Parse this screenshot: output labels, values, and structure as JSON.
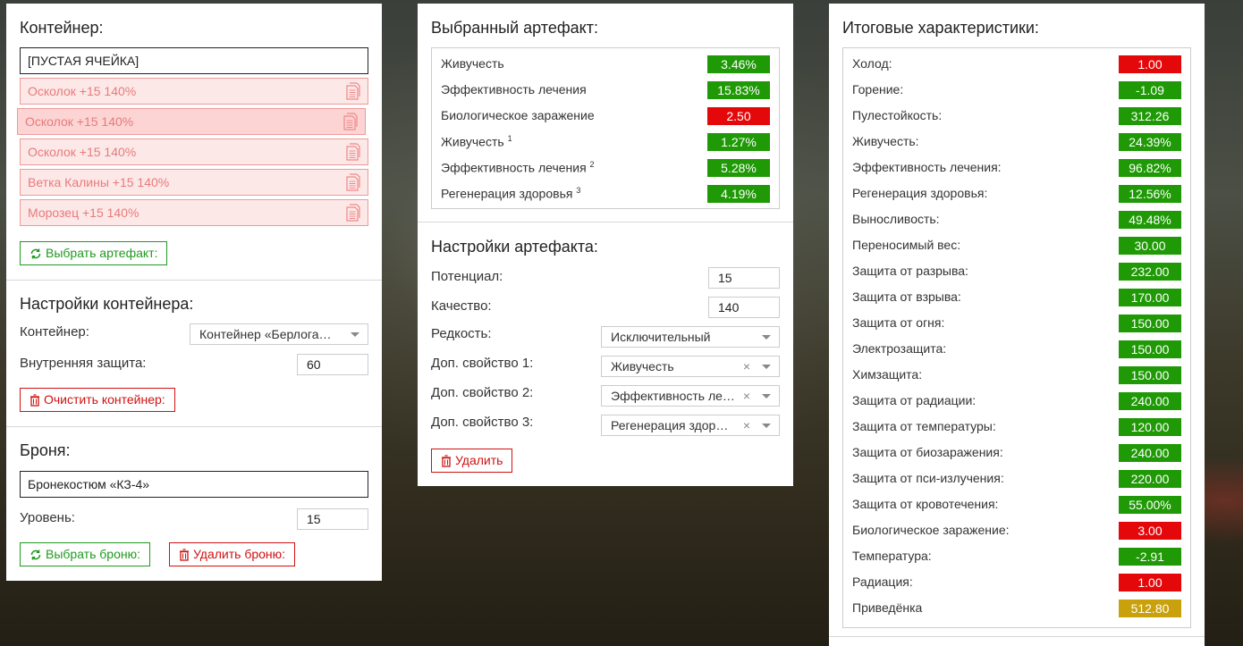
{
  "colors": {
    "good": "#1f9a06",
    "bad": "#e4080a",
    "neutral": "#c9a10d",
    "accent_green": "#1f9a1f",
    "accent_red": "#d01010"
  },
  "container": {
    "title": "Контейнер:",
    "empty_slot": "[ПУСТАЯ ЯЧЕЙКА]",
    "slots": [
      "Осколок +15 140%",
      "Осколок +15 140%",
      "Осколок +15 140%",
      "Ветка Калины +15 140%",
      "Морозец +15 140%"
    ],
    "select_artifact_button": "Выбрать артефакт:"
  },
  "container_settings": {
    "title": "Настройки контейнера:",
    "container_label": "Контейнер:",
    "container_value": "Контейнер «Берлога…",
    "inner_protection_label": "Внутренняя защита:",
    "inner_protection_value": "60",
    "clear_button": "Очистить контейнер:"
  },
  "armor": {
    "title": "Броня:",
    "armor_value": "Бронекостюм «КЗ-4»",
    "level_label": "Уровень:",
    "level_value": "15",
    "select_button": "Выбрать броню:",
    "delete_button": "Удалить броню:"
  },
  "selected_artifact": {
    "title": "Выбранный артефакт:",
    "stats": [
      {
        "label": "Живучесть",
        "sup": "",
        "value": "3.46%",
        "status": "good"
      },
      {
        "label": "Эффективность лечения",
        "sup": "",
        "value": "15.83%",
        "status": "good"
      },
      {
        "label": "Биологическое заражение",
        "sup": "",
        "value": "2.50",
        "status": "bad"
      },
      {
        "label": "Живучесть",
        "sup": "1",
        "value": "1.27%",
        "status": "good"
      },
      {
        "label": "Эффективность лечения",
        "sup": "2",
        "value": "5.28%",
        "status": "good"
      },
      {
        "label": "Регенерация здоровья",
        "sup": "3",
        "value": "4.19%",
        "status": "good"
      }
    ]
  },
  "artifact_settings": {
    "title": "Настройки артефакта:",
    "potential_label": "Потенциал:",
    "potential_value": "15",
    "quality_label": "Качество:",
    "quality_value": "140",
    "rarity_label": "Редкость:",
    "rarity_value": "Исключительный",
    "prop1_label": "Доп. свойство 1:",
    "prop1_value": "Живучесть",
    "prop2_label": "Доп. свойство 2:",
    "prop2_value": "Эффективность ле…",
    "prop3_label": "Доп. свойство 3:",
    "prop3_value": "Регенерация здор…",
    "clear_x": "×",
    "delete_button": "Удалить"
  },
  "totals": {
    "title": "Итоговые характеристики:",
    "stats": [
      {
        "label": "Холод:",
        "value": "1.00",
        "status": "bad"
      },
      {
        "label": "Горение:",
        "value": "-1.09",
        "status": "good"
      },
      {
        "label": "Пулестойкость:",
        "value": "312.26",
        "status": "good"
      },
      {
        "label": "Живучесть:",
        "value": "24.39%",
        "status": "good"
      },
      {
        "label": "Эффективность лечения:",
        "value": "96.82%",
        "status": "good"
      },
      {
        "label": "Регенерация здоровья:",
        "value": "12.56%",
        "status": "good"
      },
      {
        "label": "Выносливость:",
        "value": "49.48%",
        "status": "good"
      },
      {
        "label": "Переносимый вес:",
        "value": "30.00",
        "status": "good"
      },
      {
        "label": "Защита от разрыва:",
        "value": "232.00",
        "status": "good"
      },
      {
        "label": "Защита от взрыва:",
        "value": "170.00",
        "status": "good"
      },
      {
        "label": "Защита от огня:",
        "value": "150.00",
        "status": "good"
      },
      {
        "label": "Электрозащита:",
        "value": "150.00",
        "status": "good"
      },
      {
        "label": "Химзащита:",
        "value": "150.00",
        "status": "good"
      },
      {
        "label": "Защита от радиации:",
        "value": "240.00",
        "status": "good"
      },
      {
        "label": "Защита от температуры:",
        "value": "120.00",
        "status": "good"
      },
      {
        "label": "Защита от биозаражения:",
        "value": "240.00",
        "status": "good"
      },
      {
        "label": "Защита от пси-излучения:",
        "value": "220.00",
        "status": "good"
      },
      {
        "label": "Защита от кровотечения:",
        "value": "55.00%",
        "status": "good"
      },
      {
        "label": "Биологическое заражение:",
        "value": "3.00",
        "status": "bad"
      },
      {
        "label": "Температура:",
        "value": "-2.91",
        "status": "good"
      },
      {
        "label": "Радиация:",
        "value": "1.00",
        "status": "bad"
      },
      {
        "label": "Приведёнка",
        "value": "512.80",
        "status": "neutral"
      }
    ]
  }
}
